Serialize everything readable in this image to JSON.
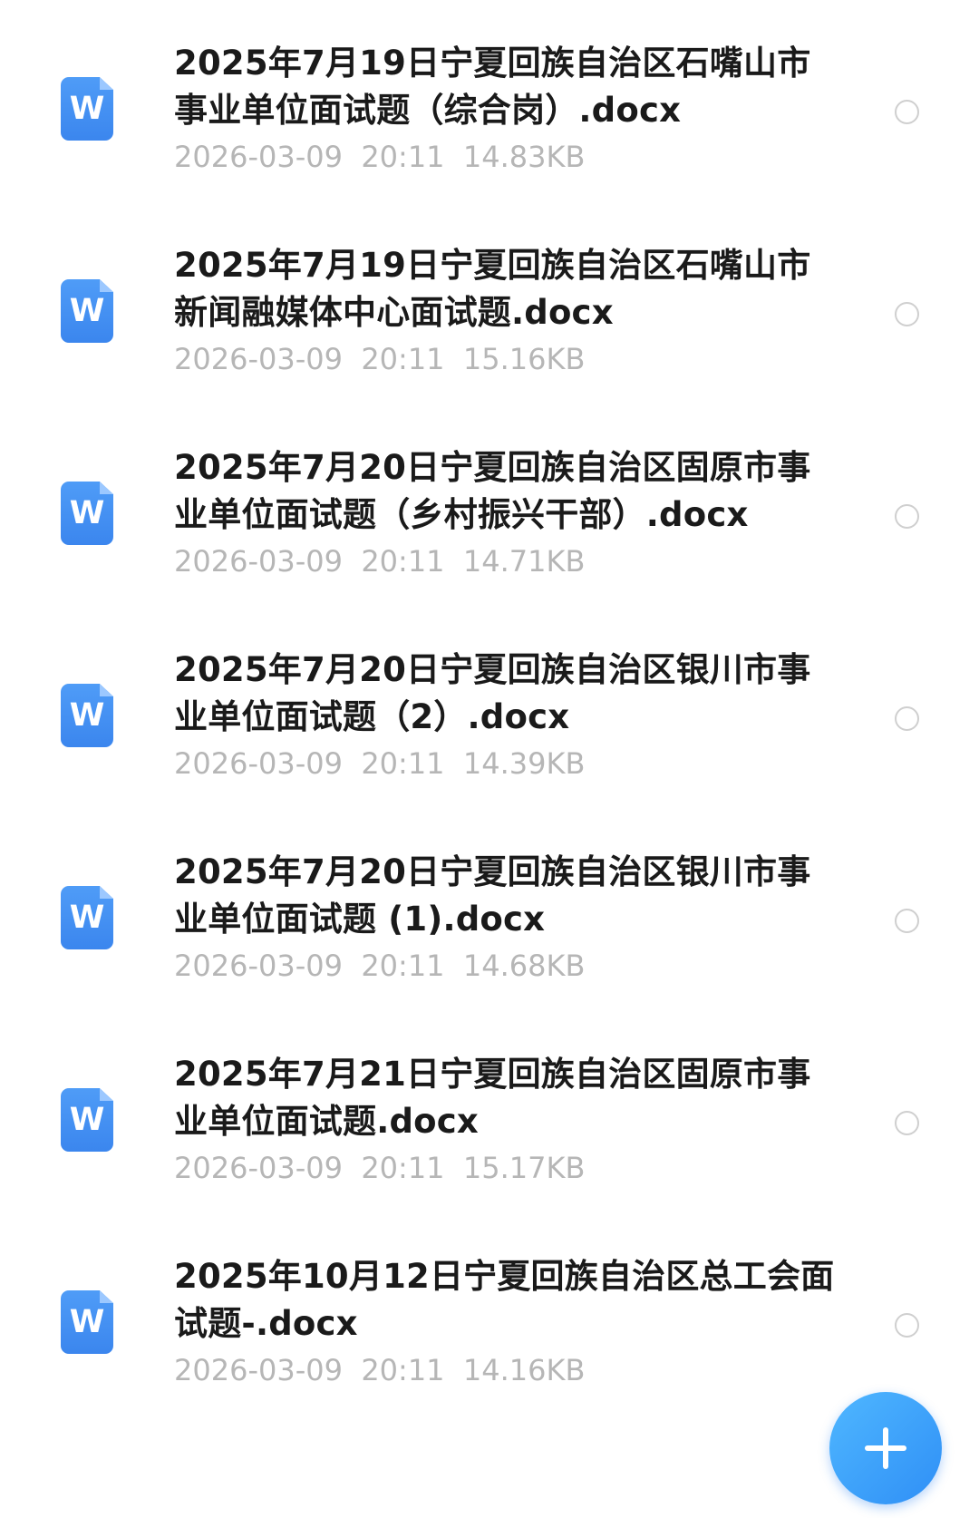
{
  "file_icon": {
    "name": "word-doc-icon",
    "letter": "W",
    "color": "#3b86ee"
  },
  "files": [
    {
      "name": "2025年7月19日宁夏回族自治区石嘴山市事业单位面试题（综合岗）.docx",
      "date": "2026-03-09",
      "time": "20:11",
      "size": "14.83KB"
    },
    {
      "name": "2025年7月19日宁夏回族自治区石嘴山市新闻融媒体中心面试题.docx",
      "date": "2026-03-09",
      "time": "20:11",
      "size": "15.16KB"
    },
    {
      "name": "2025年7月20日宁夏回族自治区固原市事业单位面试题（乡村振兴干部）.docx",
      "date": "2026-03-09",
      "time": "20:11",
      "size": "14.71KB"
    },
    {
      "name": "2025年7月20日宁夏回族自治区银川市事业单位面试题（2）.docx",
      "date": "2026-03-09",
      "time": "20:11",
      "size": "14.39KB"
    },
    {
      "name": "2025年7月20日宁夏回族自治区银川市事业单位面试题 (1).docx",
      "date": "2026-03-09",
      "time": "20:11",
      "size": "14.68KB"
    },
    {
      "name": "2025年7月21日宁夏回族自治区固原市事业单位面试题.docx",
      "date": "2026-03-09",
      "time": "20:11",
      "size": "15.17KB"
    },
    {
      "name": "2025年10月12日宁夏回族自治区总工会面试题-.docx",
      "date": "2026-03-09",
      "time": "20:11",
      "size": "14.16KB"
    }
  ],
  "fab": {
    "icon": "plus-icon",
    "color": "#2f8ff6"
  }
}
